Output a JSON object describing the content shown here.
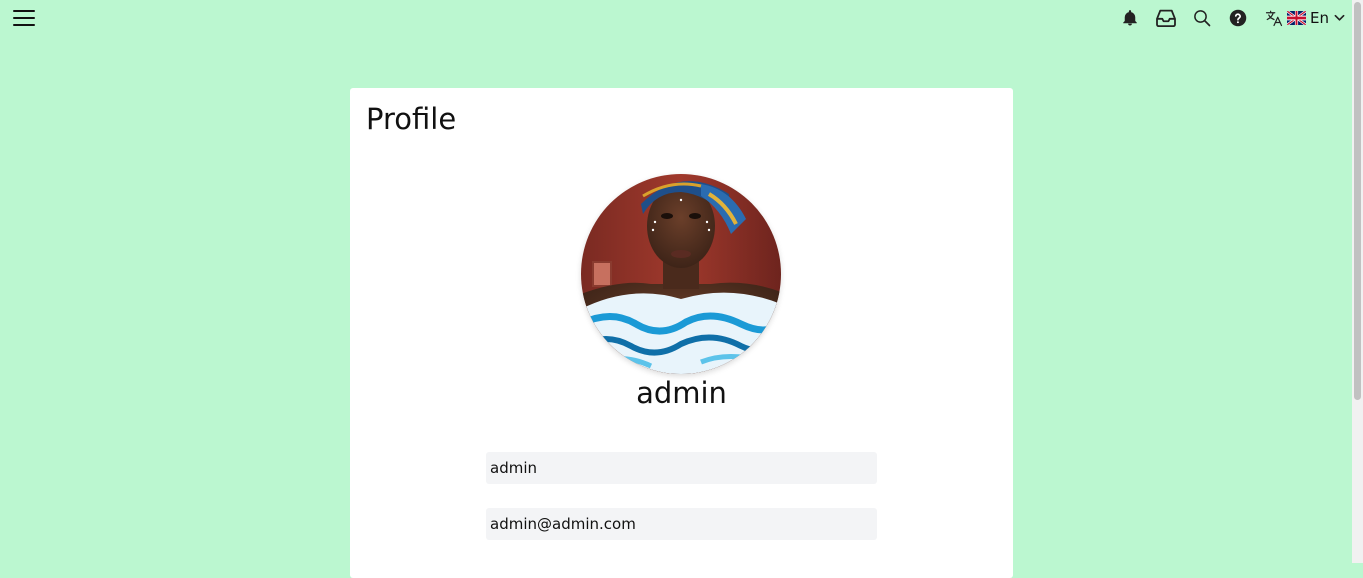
{
  "topbar": {
    "menu_icon": "hamburger-menu-icon",
    "icons": [
      "bell-icon",
      "inbox-icon",
      "search-icon",
      "help-icon",
      "translate-icon"
    ],
    "language": {
      "flag": "uk-flag",
      "label": "En",
      "caret_icon": "chevron-down-icon"
    }
  },
  "profile": {
    "title": "Profile",
    "username": "admin",
    "fields": {
      "username_value": "admin",
      "email_value": "admin@admin.com"
    }
  },
  "colors": {
    "page_background": "#bbf7d0",
    "card_background": "#ffffff",
    "input_background": "#f3f4f6"
  }
}
